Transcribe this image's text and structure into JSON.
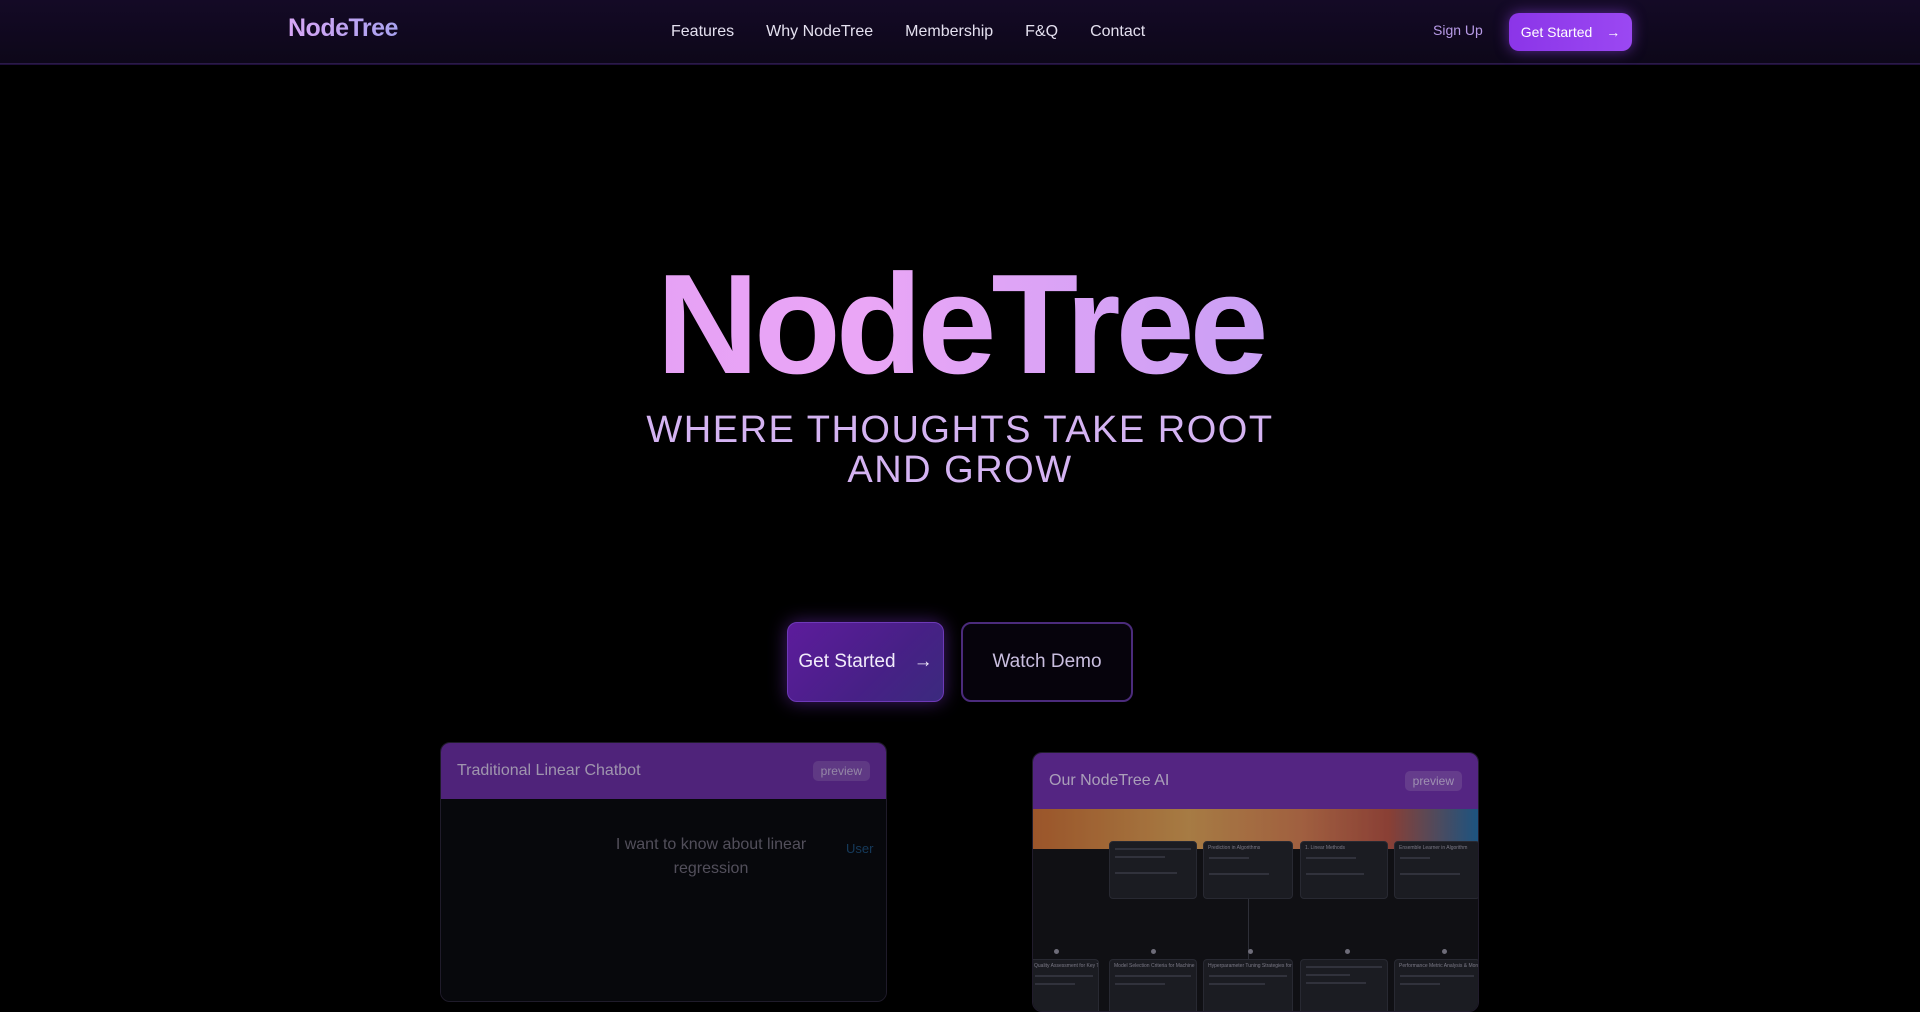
{
  "nav": {
    "brand": "NodeTree",
    "links": [
      "Features",
      "Why NodeTree",
      "Membership",
      "F&Q",
      "Contact"
    ],
    "sign_up": "Sign Up",
    "get_started": "Get Started"
  },
  "hero": {
    "title": "NodeTree",
    "subtitle": "WHERE THOUGHTS TAKE ROOT AND GROW",
    "primary_cta": "Get Started",
    "secondary_cta": "Watch Demo"
  },
  "cards": {
    "linear": {
      "title": "Traditional Linear Chatbot",
      "badge": "preview",
      "message": "I want to know about linear regression",
      "role": "User"
    },
    "nodetree": {
      "title": "Our NodeTree AI",
      "badge": "preview",
      "nodes": [
        "Prediction in Algorithms",
        "1. Linear Methods",
        "Ensemble Learner in Algorithm",
        "Quality Assessment for Key Techniques",
        "Model Selection Criteria for Machine Learning Architecture Tasks",
        "Hyperparameter Tuning Strategies for Model Optimization",
        "Performance Metric Analysis & Monitoring Techniques"
      ]
    }
  },
  "colors": {
    "accent": "#9b48f2",
    "card_header": "#6a2fa3",
    "background": "#000000"
  },
  "icons": {
    "arrow": "→"
  }
}
